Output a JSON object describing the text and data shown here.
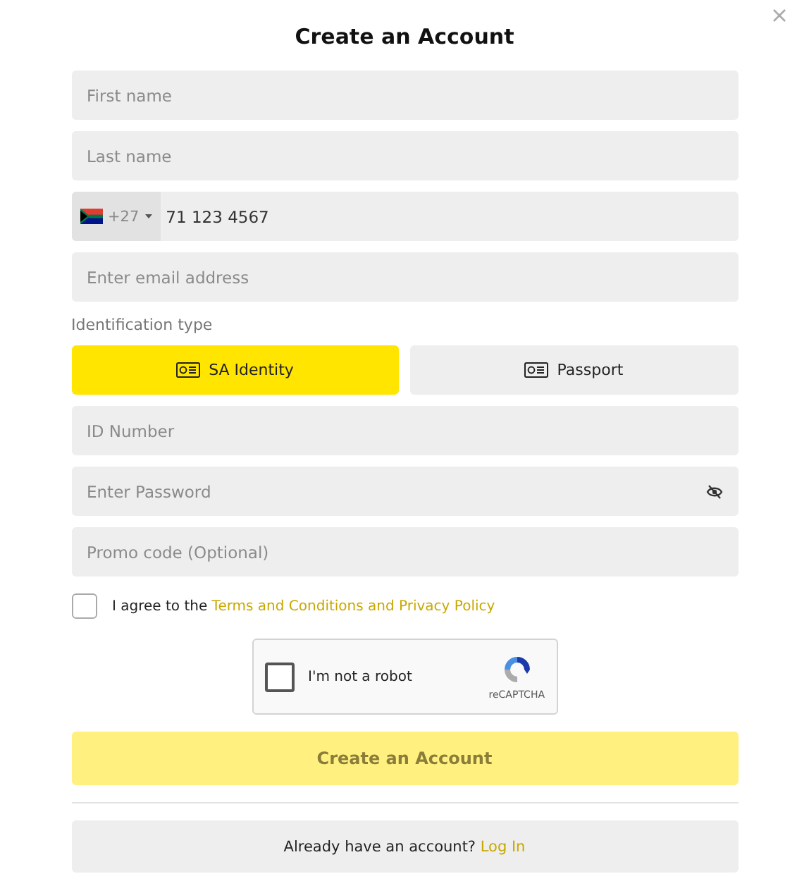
{
  "dialog": {
    "title": "Create an Account"
  },
  "name_fields": [
    {
      "placeholder": "First name"
    },
    {
      "placeholder": "Last name"
    }
  ],
  "phone": {
    "code": "+27",
    "value": "71 123 4567"
  },
  "email": {
    "placeholder": "Enter email address"
  },
  "identification": {
    "label": "Identification type",
    "options": [
      {
        "label": "SA Identity",
        "selected": true
      },
      {
        "label": "Passport",
        "selected": false
      }
    ]
  },
  "id_number": {
    "placeholder": "ID Number"
  },
  "password": {
    "placeholder": "Enter Password"
  },
  "promo": {
    "placeholder": "Promo code (Optional)"
  },
  "terms": {
    "checked": false,
    "text": "I agree to the",
    "link": "Terms and Conditions and Privacy Policy"
  },
  "captcha": {
    "checked": false,
    "label": "I'm not a robot",
    "brand": "reCAPTCHA"
  },
  "submit": {
    "label": "Create an Account",
    "disabled": true
  },
  "login": {
    "text": "Already have an account?",
    "link": "Log In"
  }
}
